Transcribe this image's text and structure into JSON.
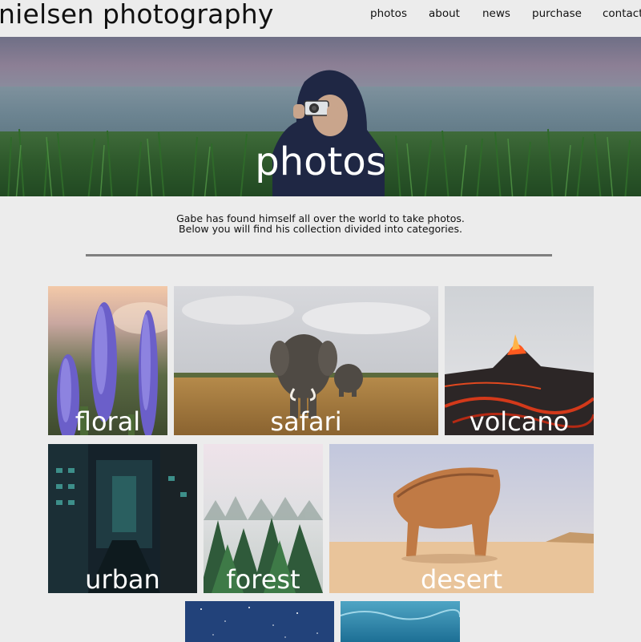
{
  "site": {
    "logo": "nielsen photography"
  },
  "nav": {
    "items": [
      {
        "label": "photos"
      },
      {
        "label": "about"
      },
      {
        "label": "news"
      },
      {
        "label": "purchase"
      },
      {
        "label": "contact"
      }
    ]
  },
  "hero": {
    "title": "photos"
  },
  "intro": {
    "line1": "Gabe has found himself all over the world to take photos.",
    "line2": "Below you will find his collection divided into categories."
  },
  "categories": [
    {
      "label": "floral"
    },
    {
      "label": "safari"
    },
    {
      "label": "volcano"
    },
    {
      "label": "urban"
    },
    {
      "label": "forest"
    },
    {
      "label": "desert"
    },
    {
      "label": ""
    },
    {
      "label": ""
    }
  ],
  "colors": {
    "background": "#ececec",
    "divider": "#7f7f7f",
    "text": "#111111",
    "overlay_text": "#ffffff"
  }
}
